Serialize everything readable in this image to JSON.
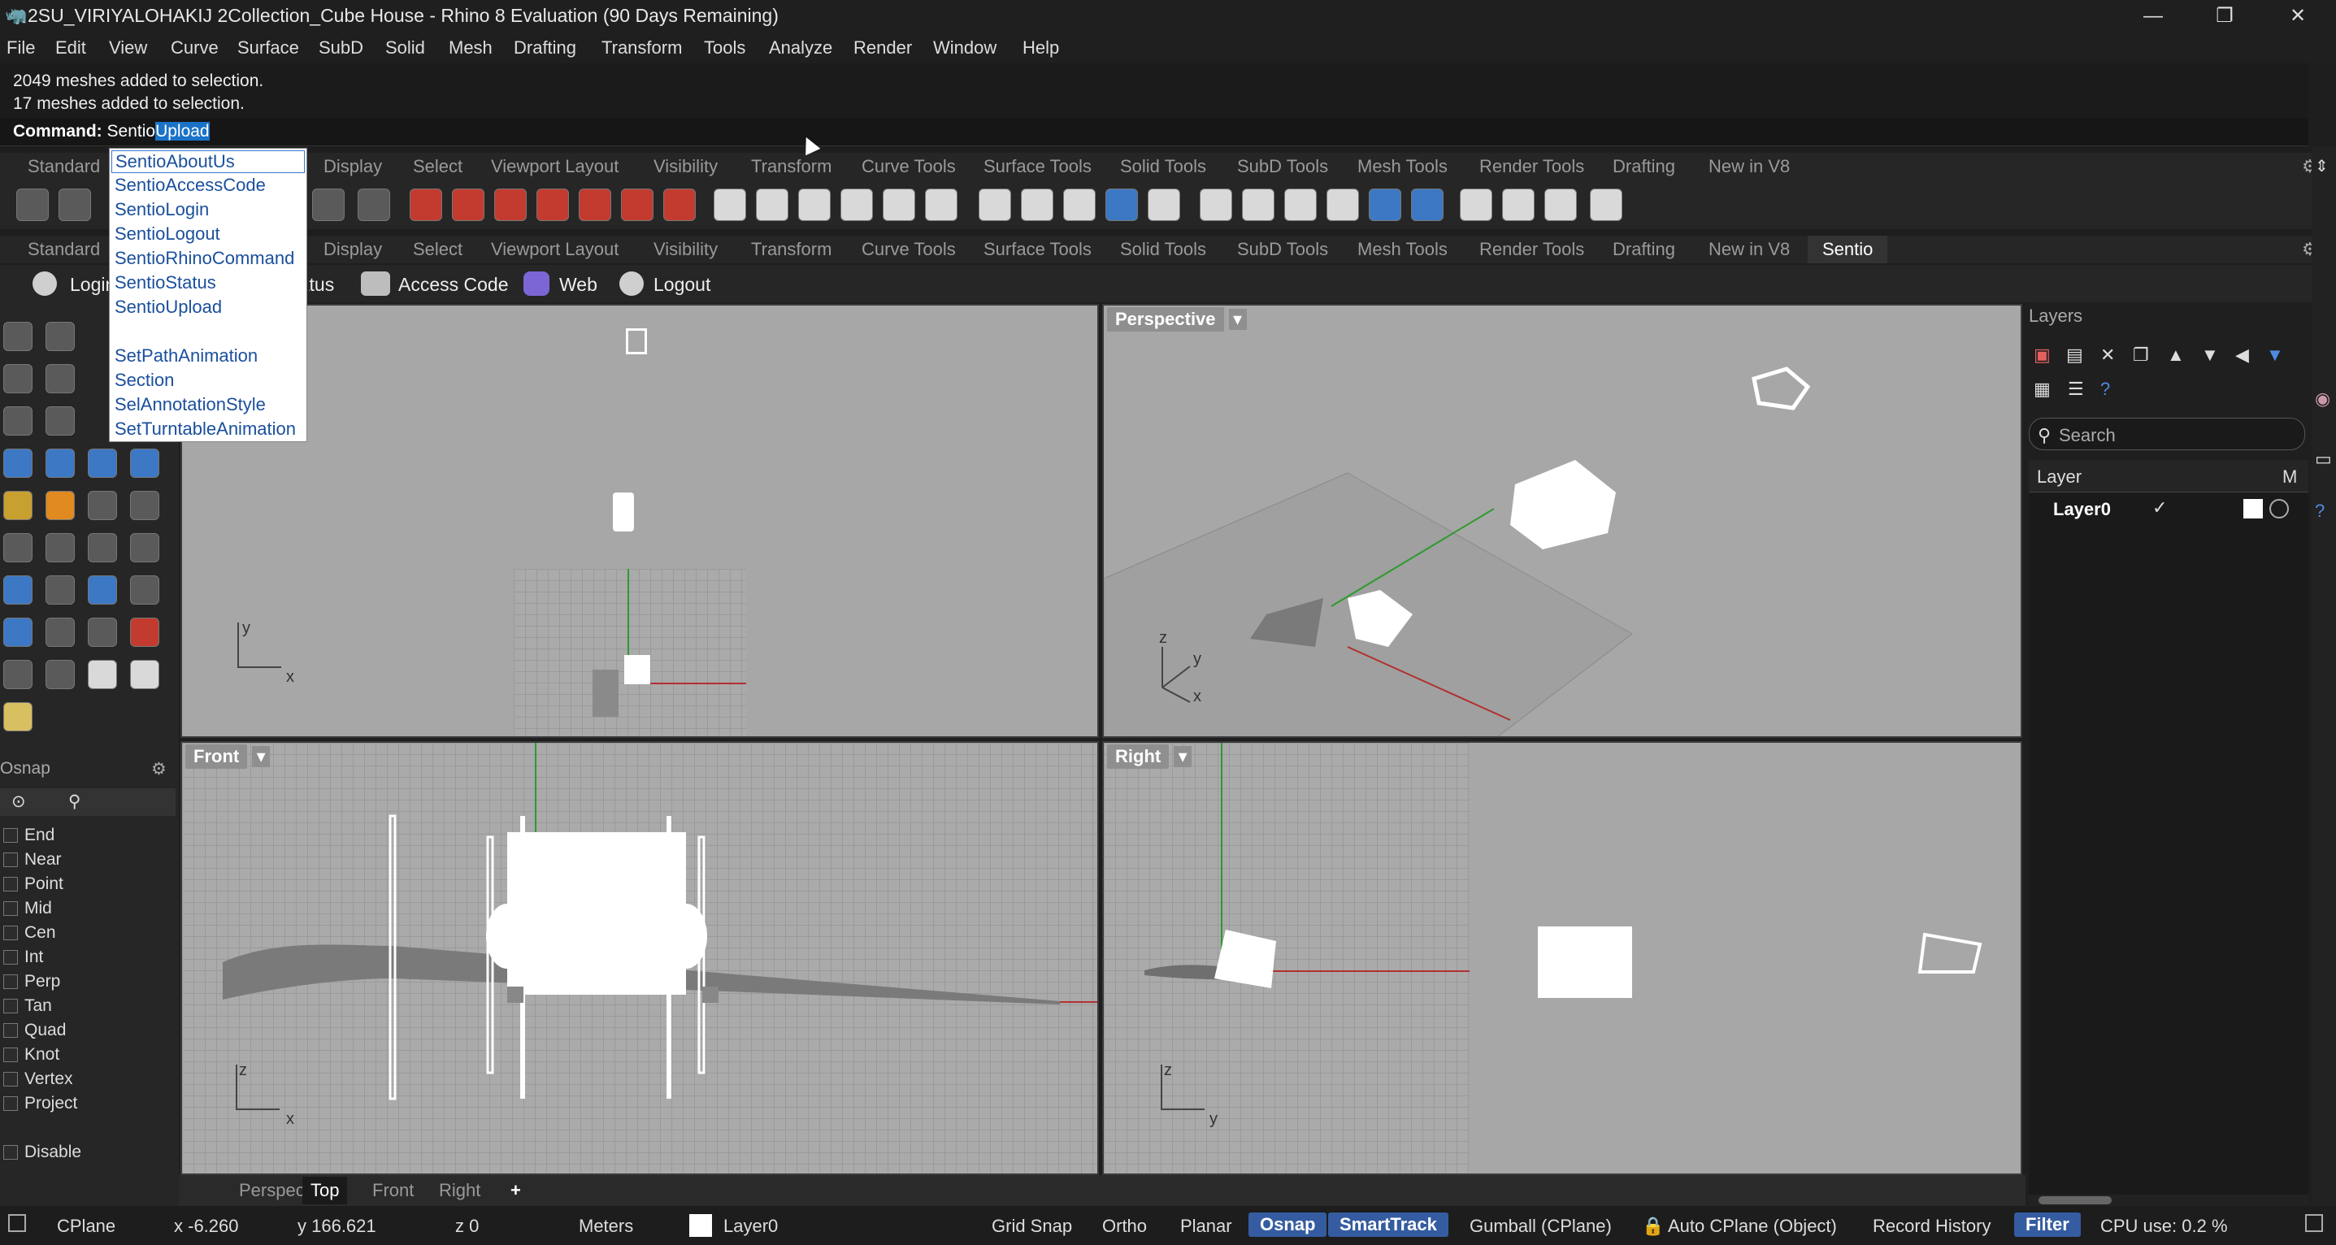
{
  "titlebar": {
    "title": "2SU_VIRIYALOHAKIJ 2Collection_Cube House - Rhino 8 Evaluation (90 Days Remaining)",
    "minimize": "—",
    "restore": "❐",
    "close": "✕"
  },
  "menu": [
    "File",
    "Edit",
    "View",
    "Curve",
    "Surface",
    "SubD",
    "Solid",
    "Mesh",
    "Drafting",
    "Transform",
    "Tools",
    "Analyze",
    "Render",
    "Window",
    "Help"
  ],
  "history": {
    "line1": "2049 meshes added to selection.",
    "line2": "17 meshes added to selection."
  },
  "command": {
    "label": "Command:",
    "typed": "Sentio",
    "autocomplete": "Upload"
  },
  "toolbar_tabs": [
    "Standard",
    "Display",
    "Select",
    "Viewport Layout",
    "Visibility",
    "Transform",
    "Curve Tools",
    "Surface Tools",
    "Solid Tools",
    "SubD Tools",
    "Mesh Tools",
    "Render Tools",
    "Drafting",
    "New in V8"
  ],
  "toolbar_tabs2_extra": "Sentio",
  "sentio_buttons": {
    "login": "Login",
    "status": "Status",
    "access_code": "Access Code",
    "web": "Web",
    "logout": "Logout"
  },
  "dropdown": {
    "items": [
      "SentioAboutUs",
      "SentioAccessCode",
      "SentioLogin",
      "SentioLogout",
      "SentioRhinoCommand",
      "SentioStatus",
      "SentioUpload",
      "",
      "SetPathAnimation",
      "Section",
      "SelAnnotationStyle",
      "SetTurntableAnimation"
    ]
  },
  "viewports": {
    "perspective": "Perspective",
    "front": "Front",
    "right": "Right",
    "axis_x": "x",
    "axis_y": "y",
    "axis_z": "z"
  },
  "osnap": {
    "title": "Osnap",
    "items": [
      "End",
      "Near",
      "Point",
      "Mid",
      "Cen",
      "Int",
      "Perp",
      "Tan",
      "Quad",
      "Knot",
      "Vertex",
      "Project"
    ],
    "disable": "Disable"
  },
  "layers": {
    "title": "Layers",
    "search_placeholder": "Search",
    "col_layer": "Layer",
    "col_m": "M",
    "layer0": "Layer0"
  },
  "vptabs": [
    "Perspective",
    "Top",
    "Front",
    "Right",
    "+"
  ],
  "status": {
    "cplane": "CPlane",
    "x": "x -6.260",
    "y": "y 166.621",
    "z": "z 0",
    "units": "Meters",
    "layer": "Layer0",
    "grid_snap": "Grid Snap",
    "ortho": "Ortho",
    "planar": "Planar",
    "osnap": "Osnap",
    "smarttrack": "SmartTrack",
    "gumball": "Gumball (CPlane)",
    "auto_cplane": "Auto CPlane (Object)",
    "record_history": "Record History",
    "filter": "Filter",
    "cpu": "CPU use: 0.2 %"
  },
  "colors": {
    "accent": "#355ca0",
    "selection": "#1a73c8",
    "viewport_bg": "#a7a7a7"
  }
}
